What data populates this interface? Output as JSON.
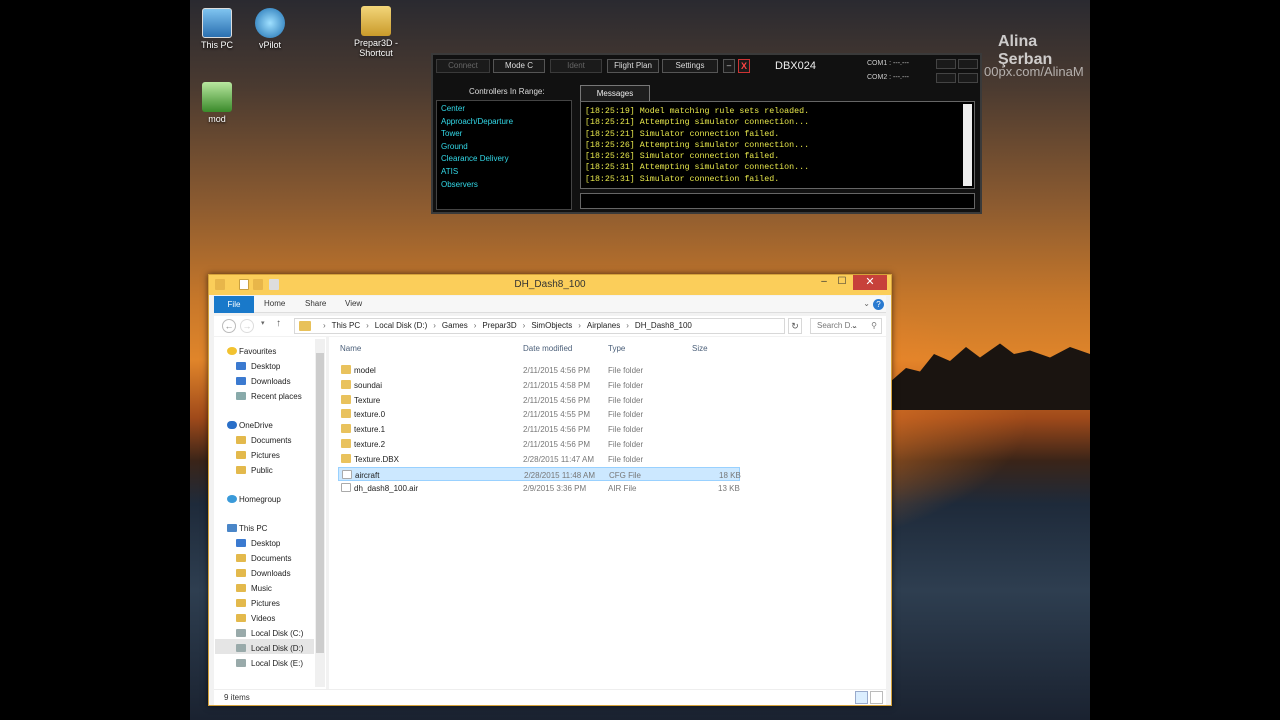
{
  "desktop": {
    "icons": [
      {
        "label": "This PC"
      },
      {
        "label": "vPilot"
      },
      {
        "label": "Prepar3D -\nShortcut"
      },
      {
        "label": "mod"
      }
    ],
    "watermark_name": "Alina Şerban",
    "watermark_url": "00px.com/AlinaM"
  },
  "vpilot": {
    "buttons": {
      "connect": "Connect",
      "mode_c": "Mode C",
      "ident": "Ident",
      "flight_plan": "Flight Plan",
      "settings": "Settings",
      "minimize": "–",
      "close": "X"
    },
    "callsign": "DBX024",
    "com1_label": "COM1 :  ---.---",
    "com2_label": "COM2 :  ---.---",
    "controllers_title": "Controllers In Range:",
    "controllers": [
      "Center",
      "Approach/Departure",
      "Tower",
      "Ground",
      "Clearance Delivery",
      "ATIS",
      "Observers"
    ],
    "messages_tab": "Messages",
    "messages": [
      "[18:25:19] Model matching rule sets reloaded.",
      "[18:25:21] Attempting simulator connection...",
      "[18:25:21] Simulator connection failed.",
      "[18:25:26] Attempting simulator connection...",
      "[18:25:26] Simulator connection failed.",
      "[18:25:31] Attempting simulator connection...",
      "[18:25:31] Simulator connection failed."
    ],
    "colors": {
      "controllers": "#33d9e8",
      "messages": "#e8e84c"
    }
  },
  "explorer": {
    "title": "DH_Dash8_100",
    "ribbon": {
      "file": "File",
      "home": "Home",
      "share": "Share",
      "view": "View"
    },
    "path": [
      "This PC",
      "Local Disk (D:)",
      "Games",
      "Prepar3D",
      "SimObjects",
      "Airplanes",
      "DH_Dash8_100"
    ],
    "search_placeholder": "Search D...",
    "nav": {
      "favourites": "Favourites",
      "favourites_items": [
        "Desktop",
        "Downloads",
        "Recent places"
      ],
      "onedrive": "OneDrive",
      "onedrive_items": [
        "Documents",
        "Pictures",
        "Public"
      ],
      "homegroup": "Homegroup",
      "thispc": "This PC",
      "thispc_items": [
        "Desktop",
        "Documents",
        "Downloads",
        "Music",
        "Pictures",
        "Videos",
        "Local Disk (C:)",
        "Local Disk (D:)",
        "Local Disk (E:)"
      ]
    },
    "columns": {
      "name": "Name",
      "date": "Date modified",
      "type": "Type",
      "size": "Size"
    },
    "files": [
      {
        "name": "model",
        "date": "2/11/2015 4:56 PM",
        "type": "File folder",
        "size": ""
      },
      {
        "name": "soundai",
        "date": "2/11/2015 4:58 PM",
        "type": "File folder",
        "size": ""
      },
      {
        "name": "Texture",
        "date": "2/11/2015 4:56 PM",
        "type": "File folder",
        "size": ""
      },
      {
        "name": "texture.0",
        "date": "2/11/2015 4:55 PM",
        "type": "File folder",
        "size": ""
      },
      {
        "name": "texture.1",
        "date": "2/11/2015 4:56 PM",
        "type": "File folder",
        "size": ""
      },
      {
        "name": "texture.2",
        "date": "2/11/2015 4:56 PM",
        "type": "File folder",
        "size": ""
      },
      {
        "name": "Texture.DBX",
        "date": "2/28/2015 11:47 AM",
        "type": "File folder",
        "size": ""
      },
      {
        "name": "aircraft",
        "date": "2/28/2015 11:48 AM",
        "type": "CFG File",
        "size": "18 KB"
      },
      {
        "name": "dh_dash8_100.air",
        "date": "2/9/2015 3:36 PM",
        "type": "AIR File",
        "size": "13 KB"
      }
    ],
    "selected_index": 7,
    "status": "9 items"
  }
}
